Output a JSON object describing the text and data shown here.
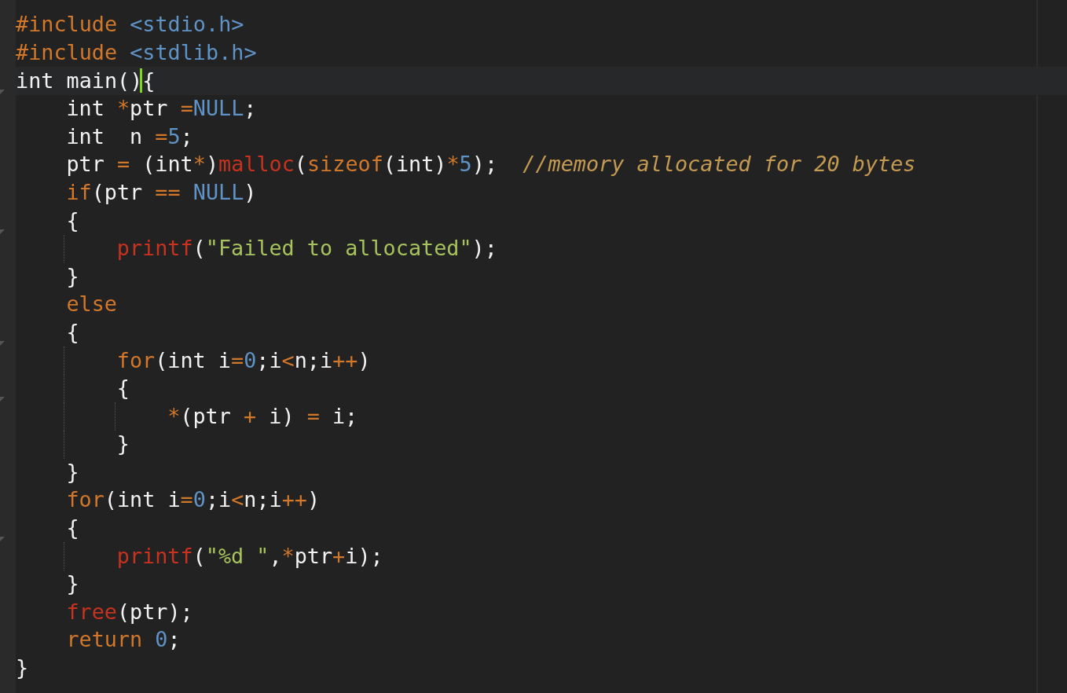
{
  "editor": {
    "lines": [
      {
        "tokens": [
          {
            "kind": "preprocessor",
            "text": "#include "
          },
          {
            "kind": "header",
            "text": "<stdio.h>"
          }
        ]
      },
      {
        "tokens": [
          {
            "kind": "preprocessor",
            "text": "#include "
          },
          {
            "kind": "header",
            "text": "<stdlib.h>"
          }
        ]
      },
      {
        "current": true,
        "fold": true,
        "tokens": [
          {
            "kind": "plain",
            "text": "int main()"
          },
          {
            "kind": "plain",
            "text": "{",
            "cursor": true
          }
        ]
      },
      {
        "tokens": [
          {
            "kind": "plain",
            "text": "    int "
          },
          {
            "kind": "operator",
            "text": "*"
          },
          {
            "kind": "plain",
            "text": "ptr "
          },
          {
            "kind": "operator",
            "text": "="
          },
          {
            "kind": "constant",
            "text": "NULL"
          },
          {
            "kind": "plain",
            "text": ";"
          }
        ]
      },
      {
        "tokens": [
          {
            "kind": "plain",
            "text": "    int  n "
          },
          {
            "kind": "operator",
            "text": "="
          },
          {
            "kind": "number",
            "text": "5"
          },
          {
            "kind": "plain",
            "text": ";"
          }
        ]
      },
      {
        "tokens": [
          {
            "kind": "plain",
            "text": "    ptr "
          },
          {
            "kind": "operator",
            "text": "="
          },
          {
            "kind": "plain",
            "text": " (int"
          },
          {
            "kind": "operator",
            "text": "*"
          },
          {
            "kind": "plain",
            "text": ")"
          },
          {
            "kind": "function",
            "text": "malloc"
          },
          {
            "kind": "plain",
            "text": "("
          },
          {
            "kind": "keyword",
            "text": "sizeof"
          },
          {
            "kind": "plain",
            "text": "(int)"
          },
          {
            "kind": "operator",
            "text": "*"
          },
          {
            "kind": "number",
            "text": "5"
          },
          {
            "kind": "plain",
            "text": ");  "
          },
          {
            "kind": "comment",
            "text": "//memory allocated for 20 bytes"
          }
        ]
      },
      {
        "tokens": [
          {
            "kind": "keyword",
            "text": "    if"
          },
          {
            "kind": "plain",
            "text": "(ptr "
          },
          {
            "kind": "operator",
            "text": "=="
          },
          {
            "kind": "constant",
            "text": " NULL"
          },
          {
            "kind": "plain",
            "text": ")"
          }
        ]
      },
      {
        "fold": true,
        "tokens": [
          {
            "kind": "plain",
            "text": "    {"
          }
        ]
      },
      {
        "tokens": [
          {
            "kind": "function",
            "text": "        printf"
          },
          {
            "kind": "plain",
            "text": "("
          },
          {
            "kind": "string",
            "text": "\"Failed to allocated\""
          },
          {
            "kind": "plain",
            "text": ");"
          }
        ]
      },
      {
        "tokens": [
          {
            "kind": "plain",
            "text": "    }"
          }
        ]
      },
      {
        "tokens": [
          {
            "kind": "keyword",
            "text": "    else"
          }
        ]
      },
      {
        "fold": true,
        "tokens": [
          {
            "kind": "plain",
            "text": "    {"
          }
        ]
      },
      {
        "tokens": [
          {
            "kind": "keyword",
            "text": "        for"
          },
          {
            "kind": "plain",
            "text": "(int i"
          },
          {
            "kind": "operator",
            "text": "="
          },
          {
            "kind": "number",
            "text": "0"
          },
          {
            "kind": "plain",
            "text": ";i"
          },
          {
            "kind": "operator",
            "text": "<"
          },
          {
            "kind": "plain",
            "text": "n;i"
          },
          {
            "kind": "operator",
            "text": "++"
          },
          {
            "kind": "plain",
            "text": ")"
          }
        ]
      },
      {
        "fold": true,
        "tokens": [
          {
            "kind": "plain",
            "text": "        {"
          }
        ]
      },
      {
        "tokens": [
          {
            "kind": "operator",
            "text": "            *"
          },
          {
            "kind": "plain",
            "text": "(ptr "
          },
          {
            "kind": "operator",
            "text": "+"
          },
          {
            "kind": "plain",
            "text": " i) "
          },
          {
            "kind": "operator",
            "text": "="
          },
          {
            "kind": "plain",
            "text": " i;"
          }
        ]
      },
      {
        "tokens": [
          {
            "kind": "plain",
            "text": "        }"
          }
        ]
      },
      {
        "tokens": [
          {
            "kind": "plain",
            "text": "    }"
          }
        ]
      },
      {
        "tokens": [
          {
            "kind": "keyword",
            "text": "    for"
          },
          {
            "kind": "plain",
            "text": "(int i"
          },
          {
            "kind": "operator",
            "text": "="
          },
          {
            "kind": "number",
            "text": "0"
          },
          {
            "kind": "plain",
            "text": ";i"
          },
          {
            "kind": "operator",
            "text": "<"
          },
          {
            "kind": "plain",
            "text": "n;i"
          },
          {
            "kind": "operator",
            "text": "++"
          },
          {
            "kind": "plain",
            "text": ")"
          }
        ]
      },
      {
        "fold": true,
        "tokens": [
          {
            "kind": "plain",
            "text": "    {"
          }
        ]
      },
      {
        "tokens": [
          {
            "kind": "function",
            "text": "        printf"
          },
          {
            "kind": "plain",
            "text": "("
          },
          {
            "kind": "string",
            "text": "\"%d \""
          },
          {
            "kind": "plain",
            "text": ","
          },
          {
            "kind": "operator",
            "text": "*"
          },
          {
            "kind": "plain",
            "text": "ptr"
          },
          {
            "kind": "operator",
            "text": "+"
          },
          {
            "kind": "plain",
            "text": "i);"
          }
        ]
      },
      {
        "tokens": [
          {
            "kind": "plain",
            "text": "    }"
          }
        ]
      },
      {
        "tokens": [
          {
            "kind": "function",
            "text": "    free"
          },
          {
            "kind": "plain",
            "text": "(ptr);"
          }
        ]
      },
      {
        "tokens": [
          {
            "kind": "keyword",
            "text": "    return"
          },
          {
            "kind": "number",
            "text": " 0"
          },
          {
            "kind": "plain",
            "text": ";"
          }
        ]
      },
      {
        "tokens": [
          {
            "kind": "plain",
            "text": "}"
          }
        ]
      }
    ]
  }
}
